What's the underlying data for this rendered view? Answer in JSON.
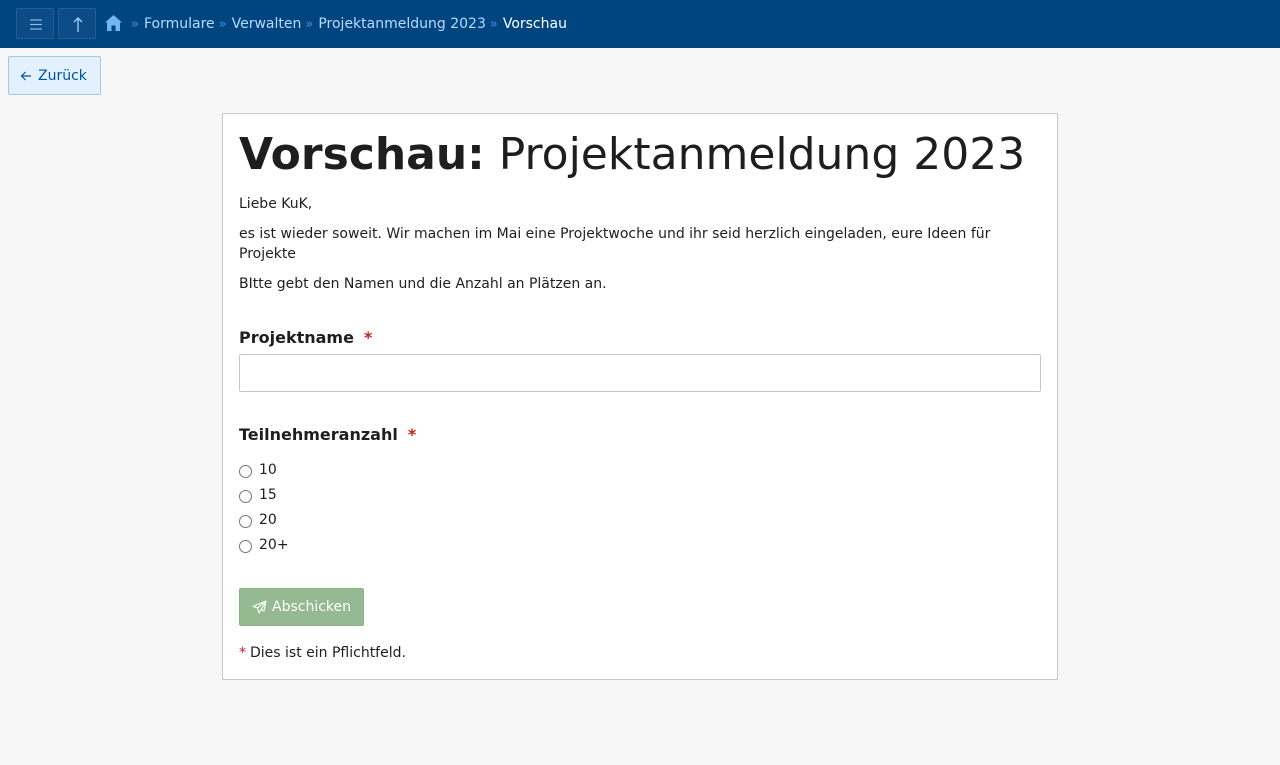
{
  "header": {
    "breadcrumb": [
      {
        "label": "Formulare"
      },
      {
        "label": "Verwalten"
      },
      {
        "label": "Projektanmeldung 2023"
      },
      {
        "label": "Vorschau"
      }
    ],
    "separator": "»"
  },
  "back_button": {
    "label": "Zurück"
  },
  "form": {
    "title_prefix": "Vorschau:",
    "title": "Projektanmeldung 2023",
    "intro": [
      "Liebe KuK,",
      "es ist wieder soweit. Wir machen im Mai eine Projektwoche und ihr seid herzlich eingeladen, eure Ideen für Projekte",
      "BItte gebt den Namen und die Anzahl an Plätzen an."
    ],
    "fields": {
      "name": {
        "label": "Projektname",
        "required_mark": "*",
        "value": ""
      },
      "participants": {
        "label": "Teilnehmeranzahl",
        "required_mark": "*",
        "options": [
          "10",
          "15",
          "20",
          "20+"
        ]
      }
    },
    "submit_label": "Abschicken",
    "required_note_mark": "*",
    "required_note": "Dies ist ein Pflichtfeld."
  },
  "colors": {
    "header_bg": "#00457f",
    "link": "#b5dbff",
    "required": "#c81e1e",
    "submit_bg": "#95b990",
    "back_bg": "#e3f1ff"
  },
  "icons": {
    "menu": "menu-icon",
    "up": "arrow-up-icon",
    "home": "home-icon",
    "back": "arrow-left-icon",
    "send": "paper-plane-icon"
  }
}
